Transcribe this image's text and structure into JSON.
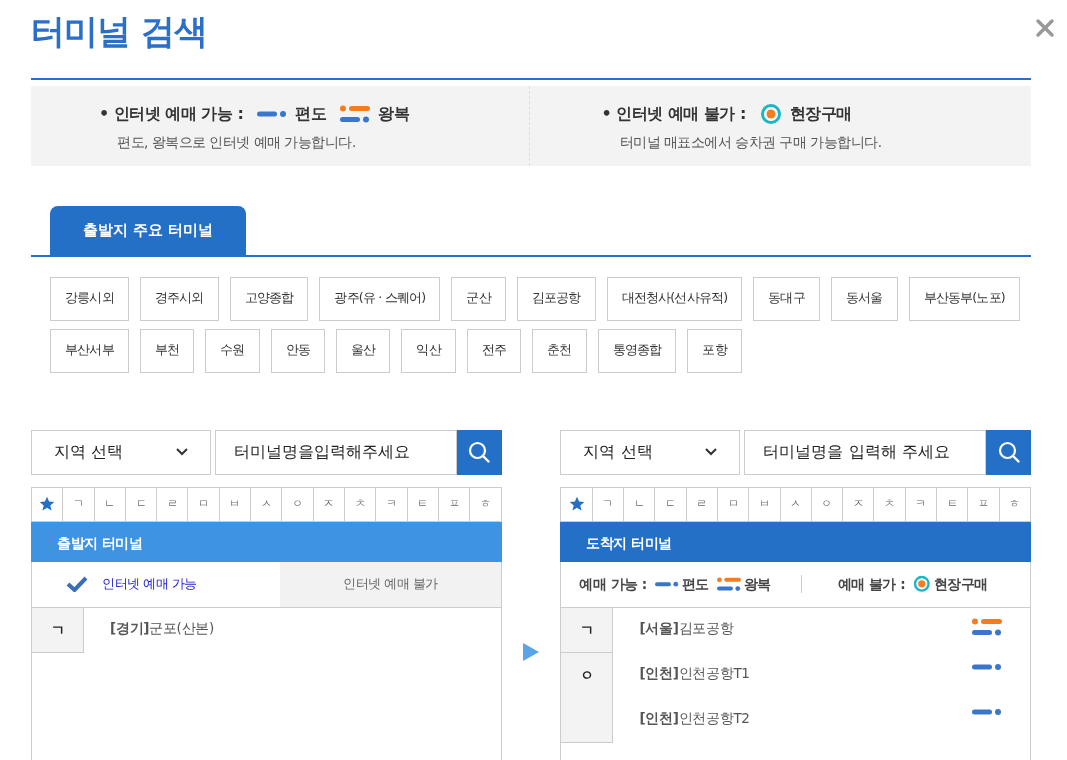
{
  "title": "터미널 검색",
  "legend": [
    {
      "label": "• 인터넷 예매 가능 :",
      "items": [
        {
          "kind": "oneway",
          "label": "편도"
        },
        {
          "kind": "roundtrip",
          "label": "왕복"
        }
      ],
      "note": "편도, 왕복으로 인터넷 예매 가능합니다."
    },
    {
      "label": "• 인터넷 예매 불가 :",
      "items": [
        {
          "kind": "onsite",
          "label": "현장구매"
        }
      ],
      "note": "터미널 매표소에서 승차권 구매 가능합니다."
    }
  ],
  "tab": {
    "label": "출발지 주요 터미널",
    "selected": true
  },
  "major_terminals": [
    "강릉시외",
    "경주시외",
    "고양종합",
    "광주(유 · 스퀘어)",
    "군산",
    "김포공항",
    "대전청사(선사유적)",
    "동대구",
    "동서울",
    "부산동부(노포)",
    "부산서부",
    "부천",
    "수원",
    "안동",
    "울산",
    "익산",
    "전주",
    "춘천",
    "통영종합",
    "포항"
  ],
  "panels": [
    {
      "region_select": "지역 선택",
      "search_placeholder": "터미널명을입력해주세요",
      "consonants": [
        "ㄱ",
        "ㄴ",
        "ㄷ",
        "ㄹ",
        "ㅁ",
        "ㅂ",
        "ㅅ",
        "ㅇ",
        "ㅈ",
        "ㅊ",
        "ㅋ",
        "ㅌ",
        "ㅍ",
        "ㅎ"
      ],
      "header": "출발지 터미널",
      "color": "#3f93e3",
      "filter_tabs": [
        {
          "label": "인터넷 예매 가능",
          "selected": true
        },
        {
          "label": "인터넷 예매 불가",
          "selected": false
        }
      ],
      "groups": [
        {
          "initial": "ㄱ",
          "terminals": [
            {
              "name": "**[경기]**군포(산본)"
            }
          ]
        }
      ]
    },
    {
      "region_select": "지역 선택",
      "search_placeholder": "터미널명을 입력해 주세요",
      "consonants": [
        "ㄱ",
        "ㄴ",
        "ㄷ",
        "ㄹ",
        "ㅁ",
        "ㅂ",
        "ㅅ",
        "ㅇ",
        "ㅈ",
        "ㅊ",
        "ㅋ",
        "ㅌ",
        "ㅍ",
        "ㅎ"
      ],
      "header": "도착지 터미널",
      "color": "#2470c6",
      "legend": [
        {
          "label": "예매 가능 :",
          "items": [
            {
              "kind": "oneway",
              "label": "편도"
            },
            {
              "kind": "roundtrip",
              "label": "왕복"
            }
          ]
        },
        {
          "label": "예매 불가 :",
          "items": [
            {
              "kind": "onsite",
              "label": "현장구매"
            }
          ]
        }
      ],
      "groups": [
        {
          "initial": "ㄱ",
          "terminals": [
            {
              "name": "**[서울]**김포공항",
              "kind": "roundtrip"
            }
          ]
        },
        {
          "initial": "ㅇ",
          "terminals": [
            {
              "name": "**[인천]**인천공항T1",
              "kind": "oneway"
            },
            {
              "name": "**[인천]**인천공항T2",
              "kind": "oneway"
            }
          ]
        }
      ]
    }
  ]
}
